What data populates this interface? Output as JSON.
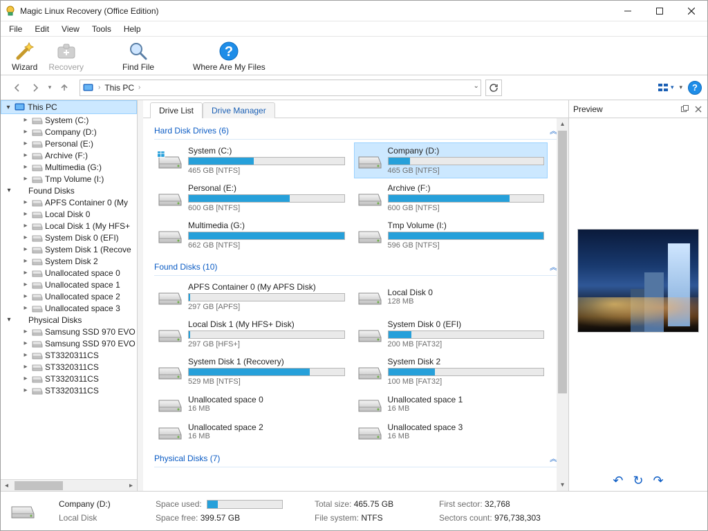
{
  "app_title": "Magic Linux Recovery (Office Edition)",
  "menu": [
    "File",
    "Edit",
    "View",
    "Tools",
    "Help"
  ],
  "toolbar": {
    "wizard": "Wizard",
    "recovery": "Recovery",
    "find_file": "Find File",
    "where_files": "Where Are My Files"
  },
  "breadcrumb": {
    "root": "This PC"
  },
  "tabs": {
    "drive_list": "Drive List",
    "drive_manager": "Drive Manager"
  },
  "tree": {
    "root": "This PC",
    "drives": [
      "System (C:)",
      "Company (D:)",
      "Personal (E:)",
      "Archive (F:)",
      "Multimedia (G:)",
      "Tmp Volume (I:)"
    ],
    "found_label": "Found Disks",
    "found": [
      "APFS Container 0 (My",
      "Local Disk 0",
      "Local Disk 1 (My HFS+",
      "System Disk 0 (EFI)",
      "System Disk 1 (Recove",
      "System Disk 2",
      "Unallocated space 0",
      "Unallocated space 1",
      "Unallocated space 2",
      "Unallocated space 3"
    ],
    "phys_label": "Physical Disks",
    "phys": [
      "Samsung SSD 970 EVO",
      "Samsung SSD 970 EVO",
      "ST3320311CS",
      "ST3320311CS",
      "ST3320311CS",
      "ST3320311CS"
    ]
  },
  "sections": {
    "hdd": {
      "title": "Hard Disk Drives",
      "count": "6"
    },
    "found": {
      "title": "Found Disks",
      "count": "10"
    },
    "phys": {
      "title": "Physical Disks",
      "count": "7"
    }
  },
  "hdd_items": [
    {
      "name": "System (C:)",
      "sub": "465 GB [NTFS]",
      "fill": 42,
      "win": true
    },
    {
      "name": "Company (D:)",
      "sub": "465 GB [NTFS]",
      "fill": 14,
      "selected": true
    },
    {
      "name": "Personal (E:)",
      "sub": "600 GB [NTFS]",
      "fill": 65
    },
    {
      "name": "Archive (F:)",
      "sub": "600 GB [NTFS]",
      "fill": 78
    },
    {
      "name": "Multimedia (G:)",
      "sub": "662 GB [NTFS]",
      "fill": 100
    },
    {
      "name": "Tmp Volume (I:)",
      "sub": "596 GB [NTFS]",
      "fill": 100
    }
  ],
  "found_items": [
    {
      "name": "APFS Container 0 (My APFS Disk)",
      "sub": "297 GB [APFS]",
      "fill": 1
    },
    {
      "name": "Local Disk 0",
      "sub": "128 MB",
      "nobar": true
    },
    {
      "name": "Local Disk 1 (My HFS+ Disk)",
      "sub": "297 GB [HFS+]",
      "fill": 1
    },
    {
      "name": "System Disk 0 (EFI)",
      "sub": "200 MB [FAT32]",
      "fill": 15
    },
    {
      "name": "System Disk 1 (Recovery)",
      "sub": "529 MB [NTFS]",
      "fill": 78
    },
    {
      "name": "System Disk 2",
      "sub": "100 MB [FAT32]",
      "fill": 30
    },
    {
      "name": "Unallocated space 0",
      "sub": "16 MB",
      "nobar": true
    },
    {
      "name": "Unallocated space 1",
      "sub": "16 MB",
      "nobar": true
    },
    {
      "name": "Unallocated space 2",
      "sub": "16 MB",
      "nobar": true
    },
    {
      "name": "Unallocated space 3",
      "sub": "16 MB",
      "nobar": true
    }
  ],
  "preview": {
    "title": "Preview"
  },
  "status": {
    "name": "Company (D:)",
    "type": "Local Disk",
    "space_used_label": "Space used:",
    "space_free_label": "Space free:",
    "space_free": "399.57 GB",
    "total_label": "Total size:",
    "total": "465.75 GB",
    "fs_label": "File system:",
    "fs": "NTFS",
    "first_sector_label": "First sector:",
    "first_sector": "32,768",
    "sectors_label": "Sectors count:",
    "sectors": "976,738,303",
    "used_fill": 14
  }
}
